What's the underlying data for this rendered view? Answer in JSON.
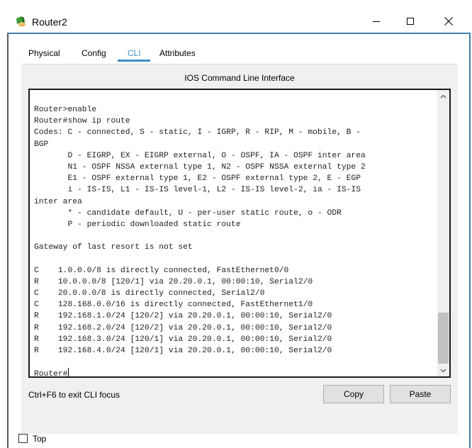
{
  "window": {
    "title": "Router2"
  },
  "tabs": [
    {
      "label": "Physical"
    },
    {
      "label": "Config"
    },
    {
      "label": "CLI"
    },
    {
      "label": "Attributes"
    }
  ],
  "active_tab": "CLI",
  "cli": {
    "heading": "IOS Command Line Interface",
    "lines": [
      "Router>enable",
      "Router#show ip route",
      "Codes: C - connected, S - static, I - IGRP, R - RIP, M - mobile, B -",
      "BGP",
      "       D - EIGRP, EX - EIGRP external, O - OSPF, IA - OSPF inter area",
      "       N1 - OSPF NSSA external type 1, N2 - OSPF NSSA external type 2",
      "       E1 - OSPF external type 1, E2 - OSPF external type 2, E - EGP",
      "       i - IS-IS, L1 - IS-IS level-1, L2 - IS-IS level-2, ia - IS-IS",
      "inter area",
      "       * - candidate default, U - per-user static route, o - ODR",
      "       P - periodic downloaded static route",
      "",
      "Gateway of last resort is not set",
      "",
      "C    1.0.0.0/8 is directly connected, FastEthernet0/0",
      "R    10.0.0.0/8 [120/1] via 20.20.0.1, 00:00:10, Serial2/0",
      "C    20.0.0.0/8 is directly connected, Serial2/0",
      "C    128.168.0.0/16 is directly connected, FastEthernet1/0",
      "R    192.168.1.0/24 [120/2] via 20.20.0.1, 00:00:10, Serial2/0",
      "R    192.168.2.0/24 [120/2] via 20.20.0.1, 00:00:10, Serial2/0",
      "R    192.168.3.0/24 [120/1] via 20.20.0.1, 00:00:10, Serial2/0",
      "R    192.168.4.0/24 [120/1] via 20.20.0.1, 00:00:10, Serial2/0",
      "",
      "Router#"
    ]
  },
  "footer": {
    "hint": "Ctrl+F6 to exit CLI focus",
    "copy_label": "Copy",
    "paste_label": "Paste"
  },
  "top_checkbox": {
    "label": "Top",
    "checked": false
  },
  "colors": {
    "accent": "#3b8ec9",
    "frame": "#3e7fb0"
  }
}
